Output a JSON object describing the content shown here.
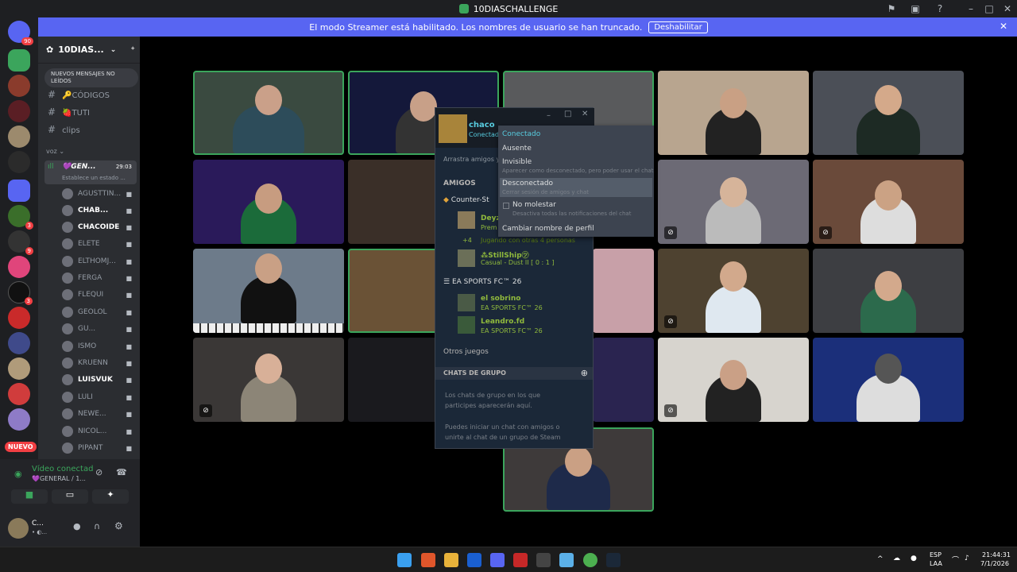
{
  "window": {
    "title": "10DIASCHALLENGE"
  },
  "banner": {
    "text": "El modo Streamer está habilitado. Los nombres de usuario se han truncado.",
    "button": "Deshabilitar"
  },
  "servers": {
    "home_badge": "90",
    "new_badge": "NUEVO",
    "badges": [
      "3",
      "3",
      "9",
      "3"
    ]
  },
  "server": {
    "name": "10DIAS...",
    "unread_pill": "NUEVOS MENSAJES NO LEÍDOS"
  },
  "channels": [
    {
      "name": "🔑CÓDIGOS"
    },
    {
      "name": "🍓TUTI"
    },
    {
      "name": "clips"
    }
  ],
  "voice_category": "voz",
  "voice_channel": {
    "name": "💜GEN...",
    "time": "29:03",
    "status": "Establece un estado ..."
  },
  "voice_users": [
    "AGUSTTIN...",
    "CHAB...",
    "CHACOIDE",
    "ELETE",
    "ELTHOMJ...",
    "FERGA",
    "FLEQUI",
    "GEOLOL",
    "GU...",
    "ISMO",
    "KRUENN",
    "LUISVUK",
    "LULI",
    "NEWE...",
    "NICOL...",
    "PIPANT"
  ],
  "voice_panel": {
    "status": "Vídeo conectad",
    "channel": "💜GENERAL / 1..."
  },
  "user_panel": {
    "name": "C...",
    "status": "• ◐..."
  },
  "steam": {
    "user": "chaco",
    "status": "Conectad",
    "search": "Arrastra amigos y",
    "friends_header": "AMIGOS",
    "groups": [
      {
        "name": "Counter-St",
        "friends": [
          {
            "name": "Deyz",
            "game": "Prem"
          },
          {
            "name": "+4",
            "game": "Jugando con otras 4 personas"
          },
          {
            "name": "⁂StillShip㋡",
            "game": "Casual - Dust II [ 0 : 1 ]"
          }
        ]
      },
      {
        "name": "EA SPORTS FC™ 26",
        "friends": [
          {
            "name": "el sobrino",
            "game": "EA SPORTS FC™ 26"
          },
          {
            "name": "Leandro.fd",
            "game": "EA SPORTS FC™ 26"
          }
        ]
      }
    ],
    "other_games": "Otros juegos",
    "group_chats_header": "CHATS DE GRUPO",
    "group_chats_text1": "Los chats de grupo en los que participes aparecerán aquí.",
    "group_chats_text2": "Puedes iniciar un chat con amigos o unirte al chat de un grupo de Steam"
  },
  "status_menu": {
    "items": [
      {
        "label": "Conectado",
        "desc": ""
      },
      {
        "label": "Ausente",
        "desc": ""
      },
      {
        "label": "Invisible",
        "desc": "Aparecer como desconectado, pero poder usar el chat"
      },
      {
        "label": "Desconectado",
        "desc": "Cerrar sesión de amigos y chat"
      },
      {
        "label": "No molestar",
        "desc": "Desactiva todas las notificaciones del chat"
      },
      {
        "label": "Cambiar nombre de perfil",
        "desc": ""
      }
    ]
  },
  "taskbar": {
    "lang1": "ESP",
    "lang2": "LAA",
    "time": "21:44:31",
    "date": "7/1/2026"
  },
  "colors": {
    "accent": "#5865f2",
    "speaking": "#3ba55c",
    "danger": "#f23f43"
  }
}
